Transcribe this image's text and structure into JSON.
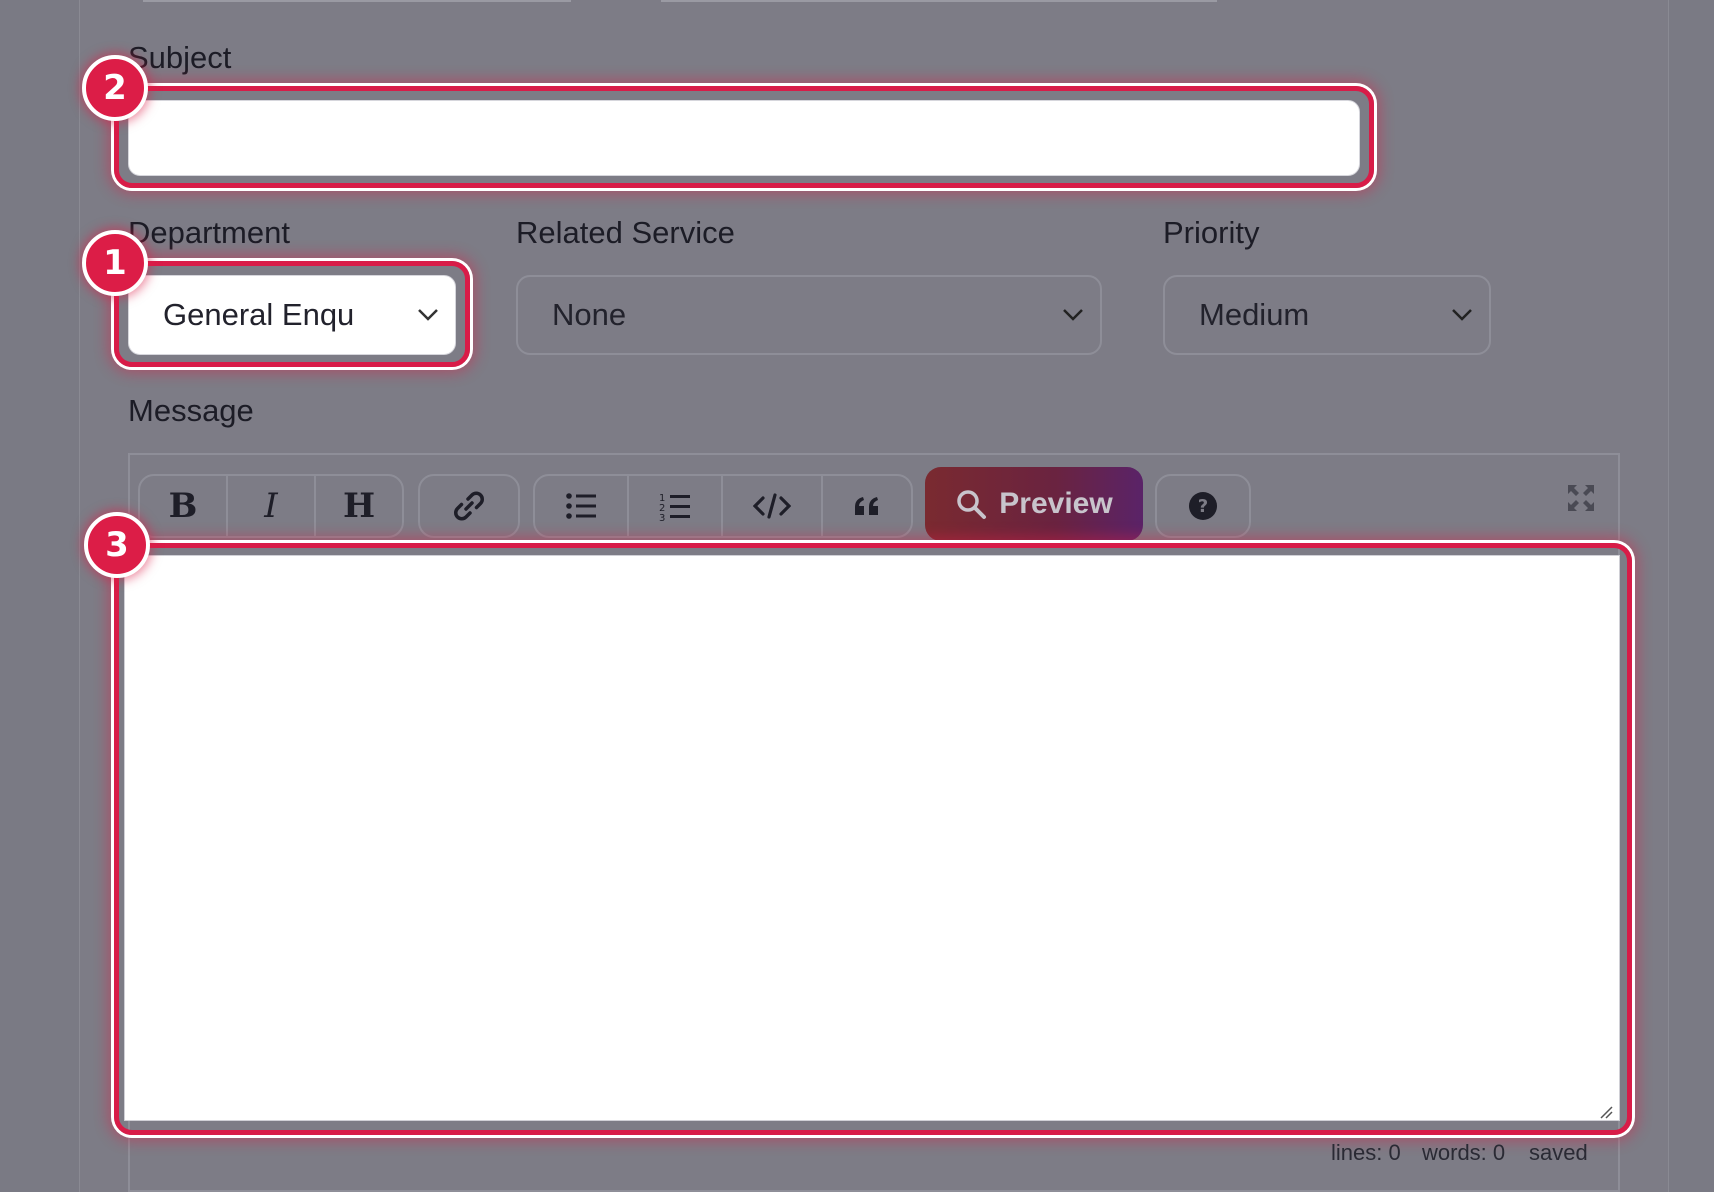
{
  "form": {
    "subject": {
      "label": "Subject",
      "value": ""
    },
    "department": {
      "label": "Department",
      "selected": "General Enqu"
    },
    "related_service": {
      "label": "Related Service",
      "selected": "None"
    },
    "priority": {
      "label": "Priority",
      "selected": "Medium"
    },
    "message": {
      "label": "Message",
      "value": ""
    }
  },
  "toolbar": {
    "bold": "B",
    "italic": "I",
    "heading": "H",
    "preview_label": "Preview"
  },
  "status_bar": {
    "lines": "lines: 0",
    "words": "words: 0",
    "state": "saved"
  },
  "annotations": [
    "1",
    "2",
    "3"
  ],
  "colors": {
    "highlight": "#dc1d47",
    "overlay": "#7d7c86",
    "preview_gradient_start": "#7a2a30",
    "preview_gradient_end": "#5a2368"
  },
  "icons": [
    "chevron-down-icon",
    "link-icon",
    "bullet-list-icon",
    "numbered-list-icon",
    "code-icon",
    "quote-icon",
    "search-icon",
    "help-icon",
    "fullscreen-icon",
    "resize-handle-icon"
  ]
}
